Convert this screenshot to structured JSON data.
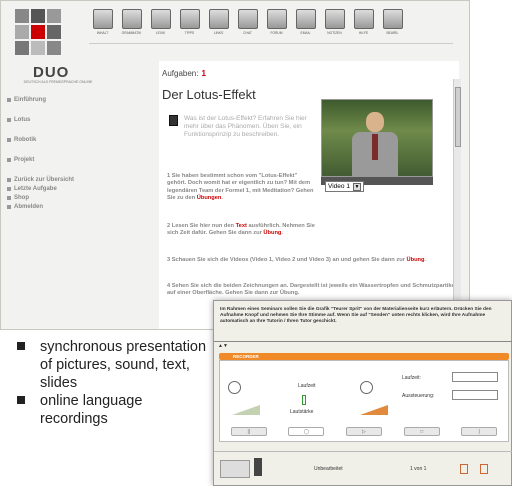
{
  "app": {
    "logo_text": "DUO",
    "logo_sub": "DEUTSCH ALS FREMDSPRACHE ONLINE"
  },
  "toolbar": [
    {
      "label": "INHALT",
      "icon": "contents-icon"
    },
    {
      "label": "GRAMMATIK",
      "icon": "grammar-icon"
    },
    {
      "label": "LEXIK",
      "icon": "lexicon-icon"
    },
    {
      "label": "TIPPS",
      "icon": "tips-icon"
    },
    {
      "label": "LINKS",
      "icon": "links-icon"
    },
    {
      "label": "CHAT",
      "icon": "chat-icon"
    },
    {
      "label": "FORUM",
      "icon": "forum-icon"
    },
    {
      "label": "EMAIL",
      "icon": "email-icon"
    },
    {
      "label": "NOTIZEN",
      "icon": "notes-icon"
    },
    {
      "label": "HILFE",
      "icon": "help-icon"
    },
    {
      "label": "BEARB.",
      "icon": "edit-icon"
    }
  ],
  "nav": [
    "Einführung",
    "Lotus",
    "Robotik",
    "Projekt",
    "Zurück zur Übersicht",
    "Letzte Aufgabe",
    "Shop",
    "Abmelden"
  ],
  "content": {
    "tasks_label": "Aufgaben:",
    "task_number": "1",
    "title": "Der Lotus-Effekt",
    "intro": "Was ist der Lotus-Effekt? Erfahren Sie hier mehr über das Phänomen. Üben Sie, ein Funktionsprinzip zu beschreiben.",
    "step1_a": "1 Sie haben bestimmt schon vom \"Lotus-Effekt\" gehört. Doch womit hat er eigentlich zu tun? Mit dem legendären Team der Formel 1, mit Meditation? Gehen Sie zu den",
    "step1_link": "Übungen",
    "step1_b": ".",
    "step2_a": "2 Lesen Sie hier nun den",
    "step2_link1": "Text",
    "step2_b": "ausführlich. Nehmen Sie sich Zeit dafür. Gehen Sie dann zur",
    "step2_link2": "Übung",
    "step2_c": ".",
    "step3_a": "3 Schauen Sie sich die Videos (Video 1, Video 2 und Video 3) an und gehen Sie dann zur",
    "step3_link": "Übung",
    "step3_b": ".",
    "step4": "4 Sehen Sie sich die beiden Zeichnungen an. Dargestellt ist jeweils ein Wassertropfen und Schmutzpartikel auf einer Oberfläche. Gehen Sie dann zur Übung."
  },
  "video": {
    "selected": "Video 1"
  },
  "recorder": {
    "instructions": "Im Rahmen eines Seminars sollen Sie die Grafik \"Teurer Sprit\" von der Materialienseite kurz erläutern. Drücken Sie den Aufnahme Knopf und nehmen Sie Ihre Stimme auf. Wenn Sie auf \"Senden\" unten rechts klicken, wird Ihre Aufnahme automatisch an Ihre Tutorin / Ihren Tutor geschickt.",
    "bar_label": "RECORDER",
    "laufzeit": "Laufzeit",
    "lautstaerke": "Lautstärke",
    "field1_label": "Laufzeit:",
    "field2_label": "Aussteuerung:",
    "status": "Unbearbeitet",
    "page": "1 von 1"
  },
  "features": [
    "synchronous presentation of pictures, sound, text, slides",
    "online language recordings"
  ],
  "colors": {
    "accent": "#cc0000",
    "recorder_bar": "#f08a28"
  }
}
